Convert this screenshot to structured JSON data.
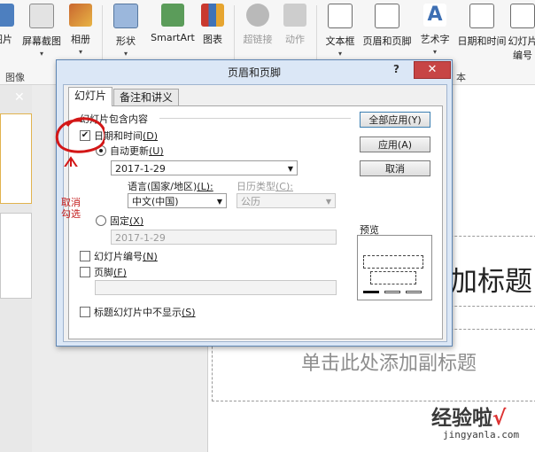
{
  "ribbon": {
    "buttons": [
      {
        "label": "图片",
        "icon": "picture-icon"
      },
      {
        "label": "屏幕截图",
        "icon": "screenshot-icon"
      },
      {
        "label": "相册",
        "icon": "album-icon"
      },
      {
        "label": "形状",
        "icon": "shapes-icon"
      },
      {
        "label": "SmartArt",
        "icon": "smartart-icon"
      },
      {
        "label": "图表",
        "icon": "chart-icon"
      },
      {
        "label": "超链接",
        "icon": "hyperlink-icon"
      },
      {
        "label": "动作",
        "icon": "action-icon"
      },
      {
        "label": "文本框",
        "icon": "textbox-icon"
      },
      {
        "label": "页眉和页脚",
        "icon": "header-footer-icon"
      },
      {
        "label": "艺术字",
        "icon": "wordart-icon"
      },
      {
        "label": "日期和时间",
        "icon": "date-time-icon"
      },
      {
        "label": "幻灯片",
        "icon": "slide-number-icon"
      }
    ],
    "extra_label": "编号",
    "groups": [
      "图像",
      "本"
    ]
  },
  "slide": {
    "title_partial": "加标题",
    "subtitle": "单击此处添加副标题"
  },
  "dialog": {
    "title": "页眉和页脚",
    "help": "?",
    "close": "✕",
    "tabs": [
      "幻灯片",
      "备注和讲义"
    ],
    "group_label": "幻灯片包含内容",
    "date_time_label": "日期和时间",
    "date_time_key": "(D)",
    "auto_update_label": "自动更新",
    "auto_update_key": "(U)",
    "auto_date_value": "2017-1-29",
    "language_label": "语言(国家/地区)",
    "language_key": "(L):",
    "language_value": "中文(中国)",
    "calendar_label": "日历类型",
    "calendar_key": "(C):",
    "calendar_value": "公历",
    "fixed_label": "固定",
    "fixed_key": "(X)",
    "fixed_value": "2017-1-29",
    "slide_number_label": "幻灯片编号",
    "slide_number_key": "(N)",
    "footer_label": "页脚",
    "footer_key": "(F)",
    "footer_value": "",
    "hide_on_title_label": "标题幻灯片中不显示",
    "hide_on_title_key": "(S)",
    "apply_all": "全部应用(Y)",
    "apply": "应用(A)",
    "cancel": "取消",
    "preview_label": "预览"
  },
  "annotation": {
    "line1": "取消",
    "line2": "勾选",
    "color": "#c41e1e"
  },
  "watermark": {
    "text": "经验啦",
    "check": "√",
    "url": "jingyanla.com"
  }
}
